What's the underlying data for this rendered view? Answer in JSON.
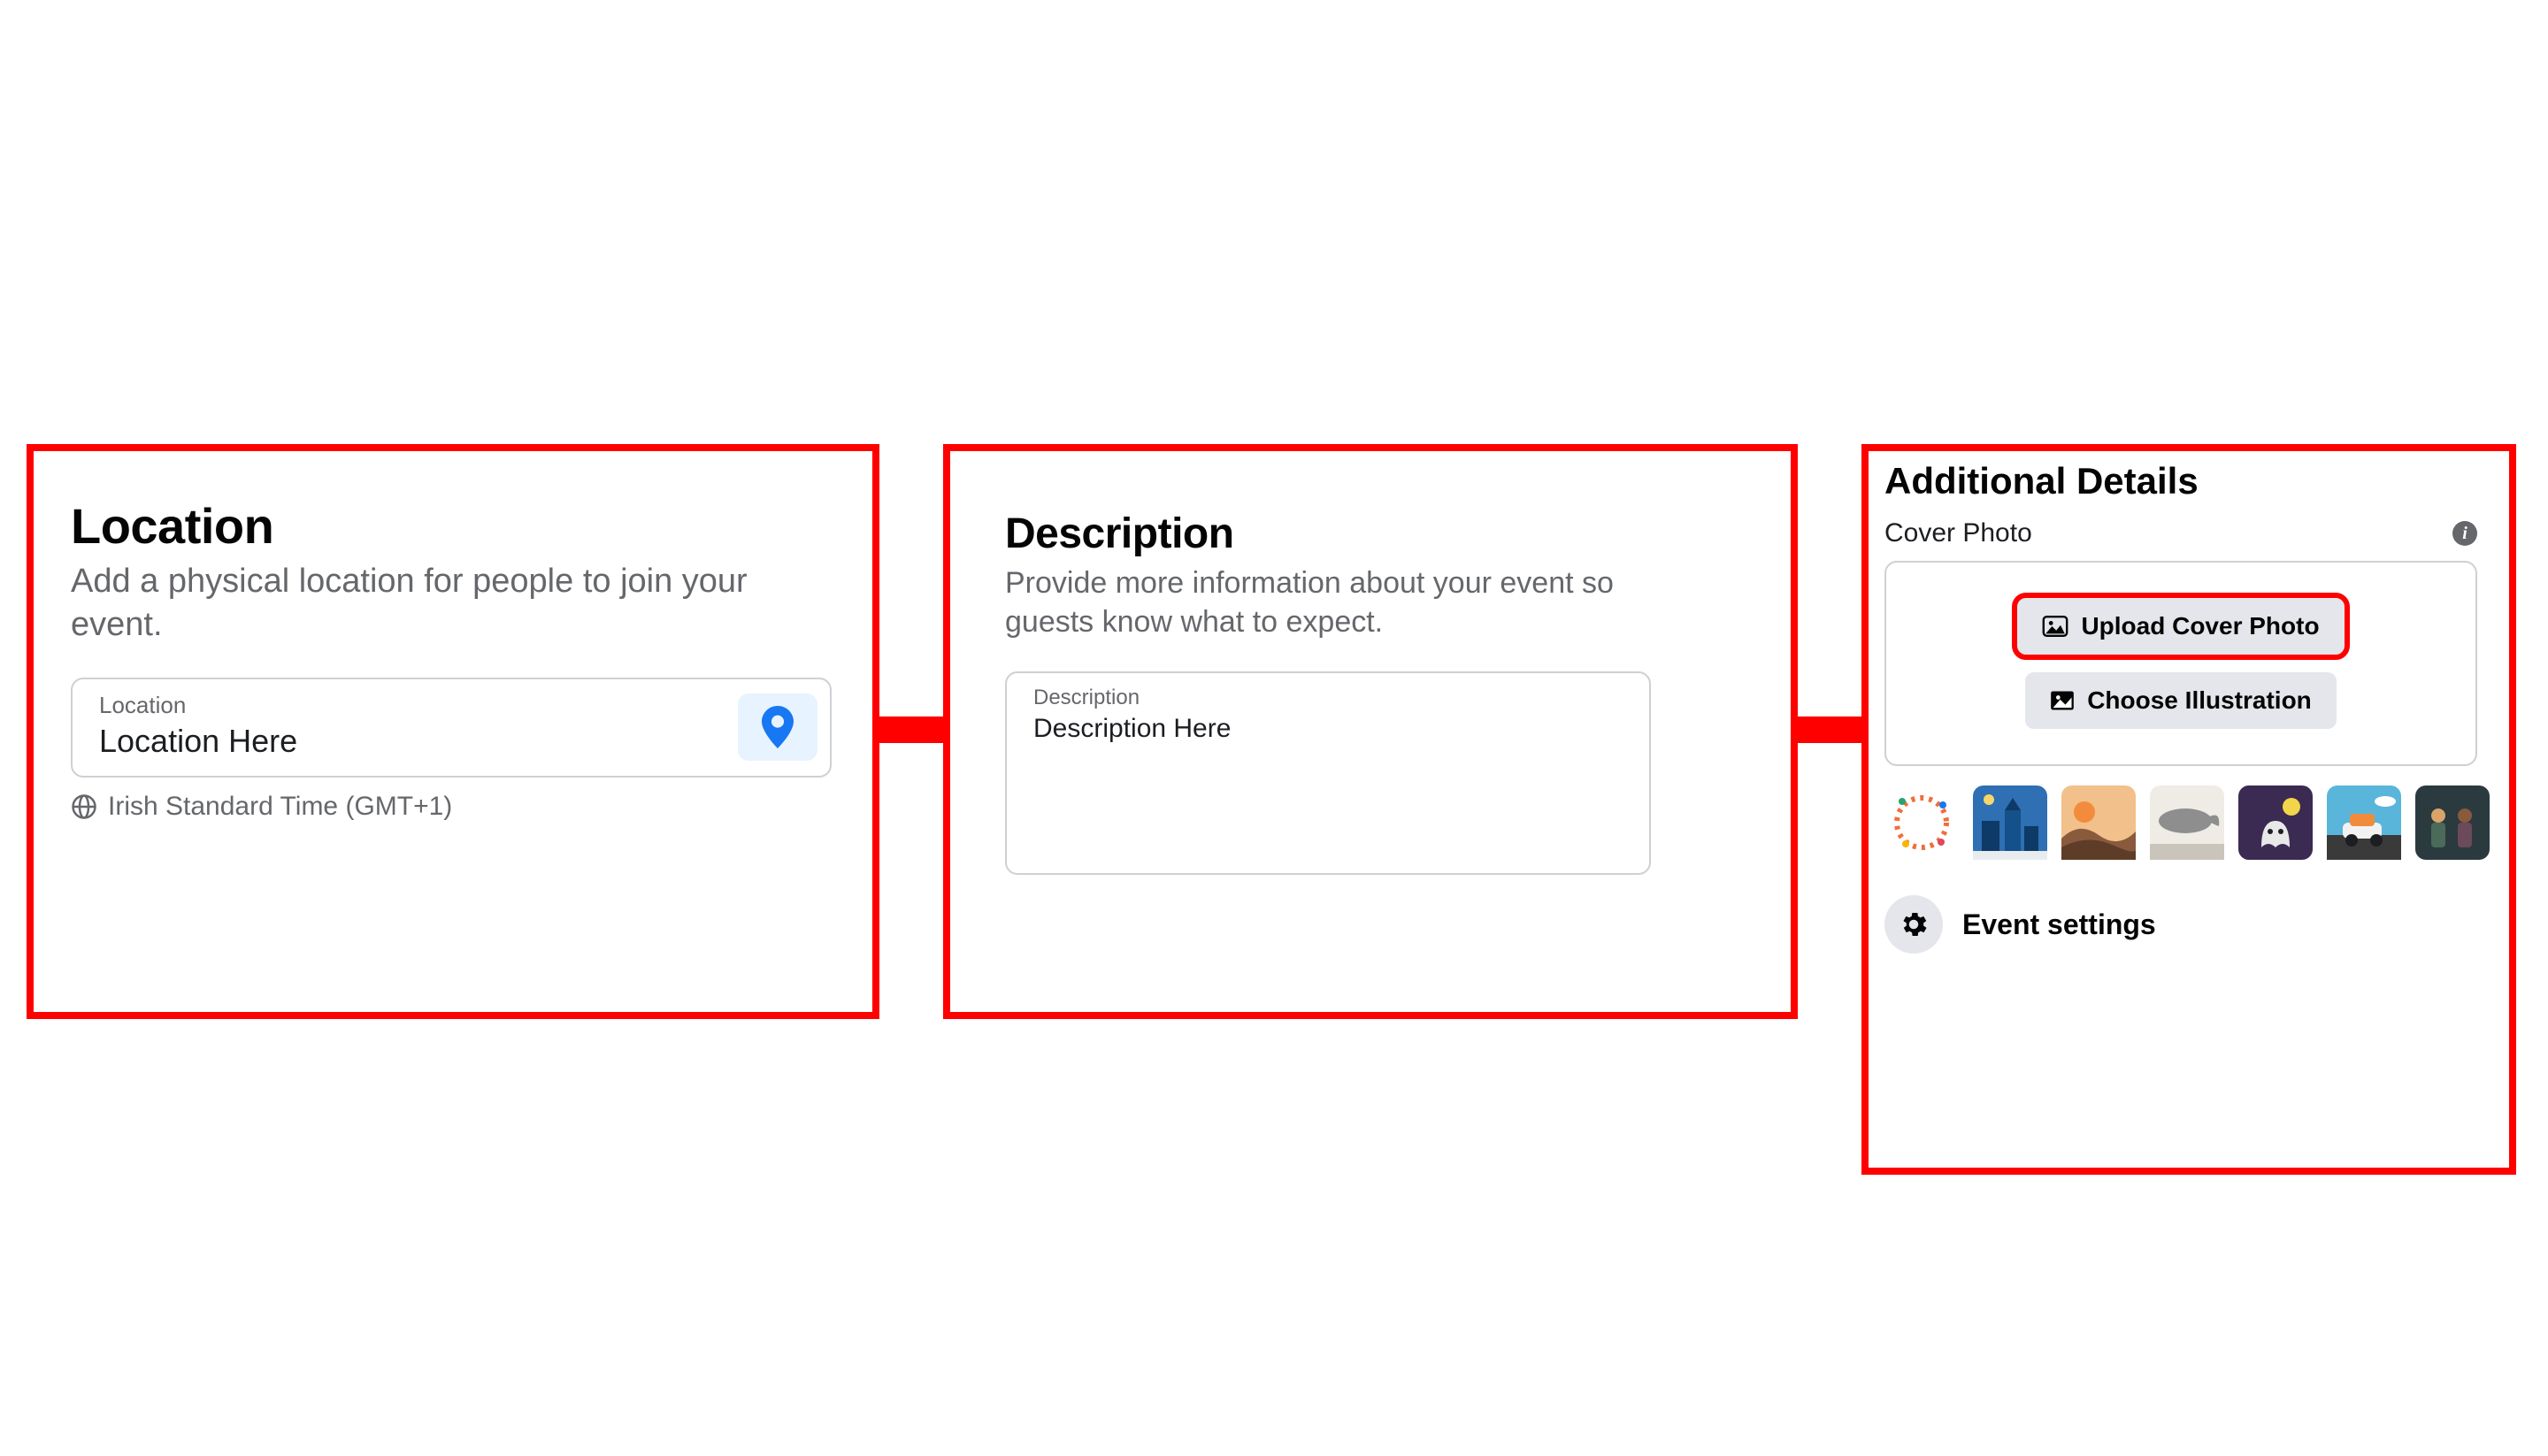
{
  "location": {
    "title": "Location",
    "subtitle": "Add a physical location for people to join your event.",
    "field_label": "Location",
    "field_value": "Location Here",
    "timezone": "Irish Standard Time (GMT+1)"
  },
  "description": {
    "title": "Description",
    "subtitle": "Provide more information about your event so guests know what to expect.",
    "field_label": "Description",
    "field_value": "Description Here"
  },
  "additional": {
    "title": "Additional Details",
    "cover_label": "Cover Photo",
    "upload_label": "Upload Cover Photo",
    "illustration_label": "Choose Illustration",
    "settings_label": "Event settings",
    "thumb_colors": [
      "#f4d6c6",
      "#2f6fb3",
      "#d9a46a",
      "#efece6",
      "#3b2a52",
      "#59b6da",
      "#2b3a3f",
      "#ffffff"
    ]
  }
}
